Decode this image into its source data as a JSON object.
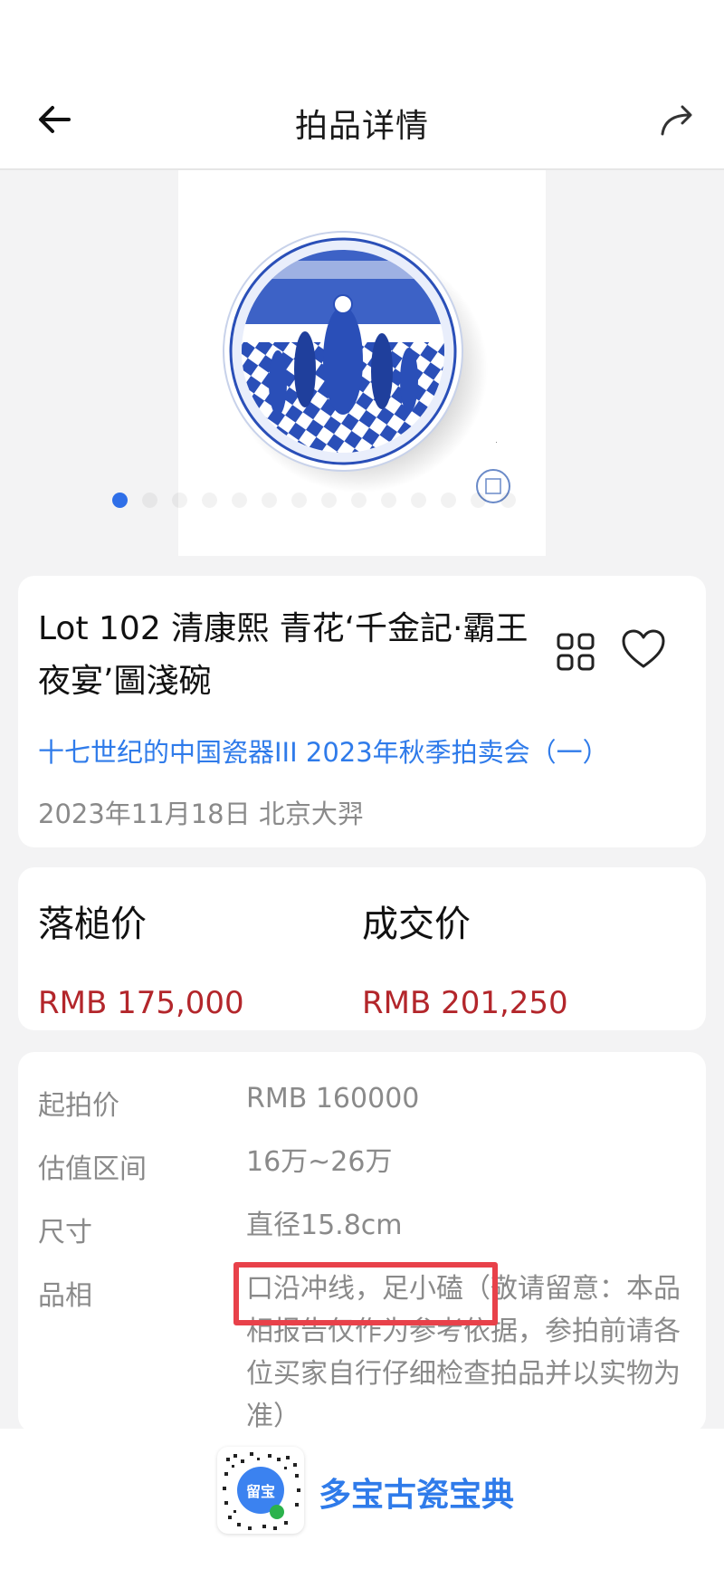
{
  "nav": {
    "title": "拍品详情"
  },
  "gallery": {
    "image_alt": "blue-and-white bowl",
    "active_index": 0,
    "dot_count": 14
  },
  "lot": {
    "title": "Lot 102 清康熙 青花‘千金記·霸王夜宴’圖淺碗",
    "auction": "十七世纪的中国瓷器III 2023年秋季拍卖会（一）",
    "date_place": "2023年11月18日 北京大羿"
  },
  "prices": {
    "hammer_label": "落槌价",
    "hammer_value": "RMB 175,000",
    "deal_label": "成交价",
    "deal_value": "RMB 201,250"
  },
  "details": {
    "start_label": "起拍价",
    "start_value": "RMB 160000",
    "estimate_label": "估值区间",
    "estimate_value": "16万~26万",
    "size_label": "尺寸",
    "size_value": "直径15.8cm",
    "condition_label": "品相",
    "condition_highlight": "口沿冲线，足小磕",
    "condition_note": "（敬请留意：本品相报告仅作为参考依据，参拍前请各位买家自行仔细检查拍品并以实物为准）"
  },
  "banner": {
    "brand": "多宝古瓷宝典",
    "qr_text": "留宝"
  },
  "colors": {
    "accent": "#2f7bea",
    "price": "#b3262b",
    "highlight": "#e8414a"
  }
}
